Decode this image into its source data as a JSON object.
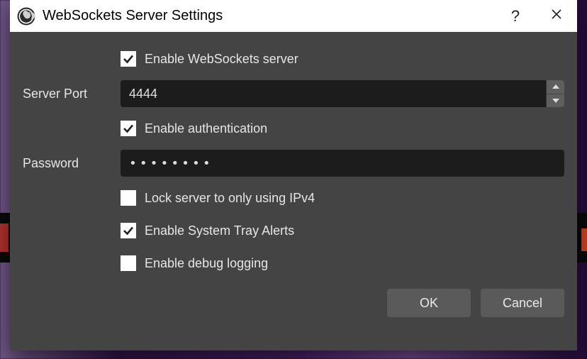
{
  "titlebar": {
    "title": "WebSockets Server Settings",
    "help_tooltip": "?",
    "close_tooltip": "Close"
  },
  "form": {
    "enable_server": {
      "label": "Enable WebSockets server",
      "checked": true
    },
    "server_port": {
      "label": "Server Port",
      "value": "4444"
    },
    "enable_auth": {
      "label": "Enable authentication",
      "checked": true
    },
    "password": {
      "label": "Password",
      "value": "••••••••"
    },
    "lock_ipv4": {
      "label": "Lock server to only using IPv4",
      "checked": false
    },
    "tray_alerts": {
      "label": "Enable System Tray Alerts",
      "checked": true
    },
    "debug_log": {
      "label": "Enable debug logging",
      "checked": false
    }
  },
  "buttons": {
    "ok": "OK",
    "cancel": "Cancel"
  }
}
